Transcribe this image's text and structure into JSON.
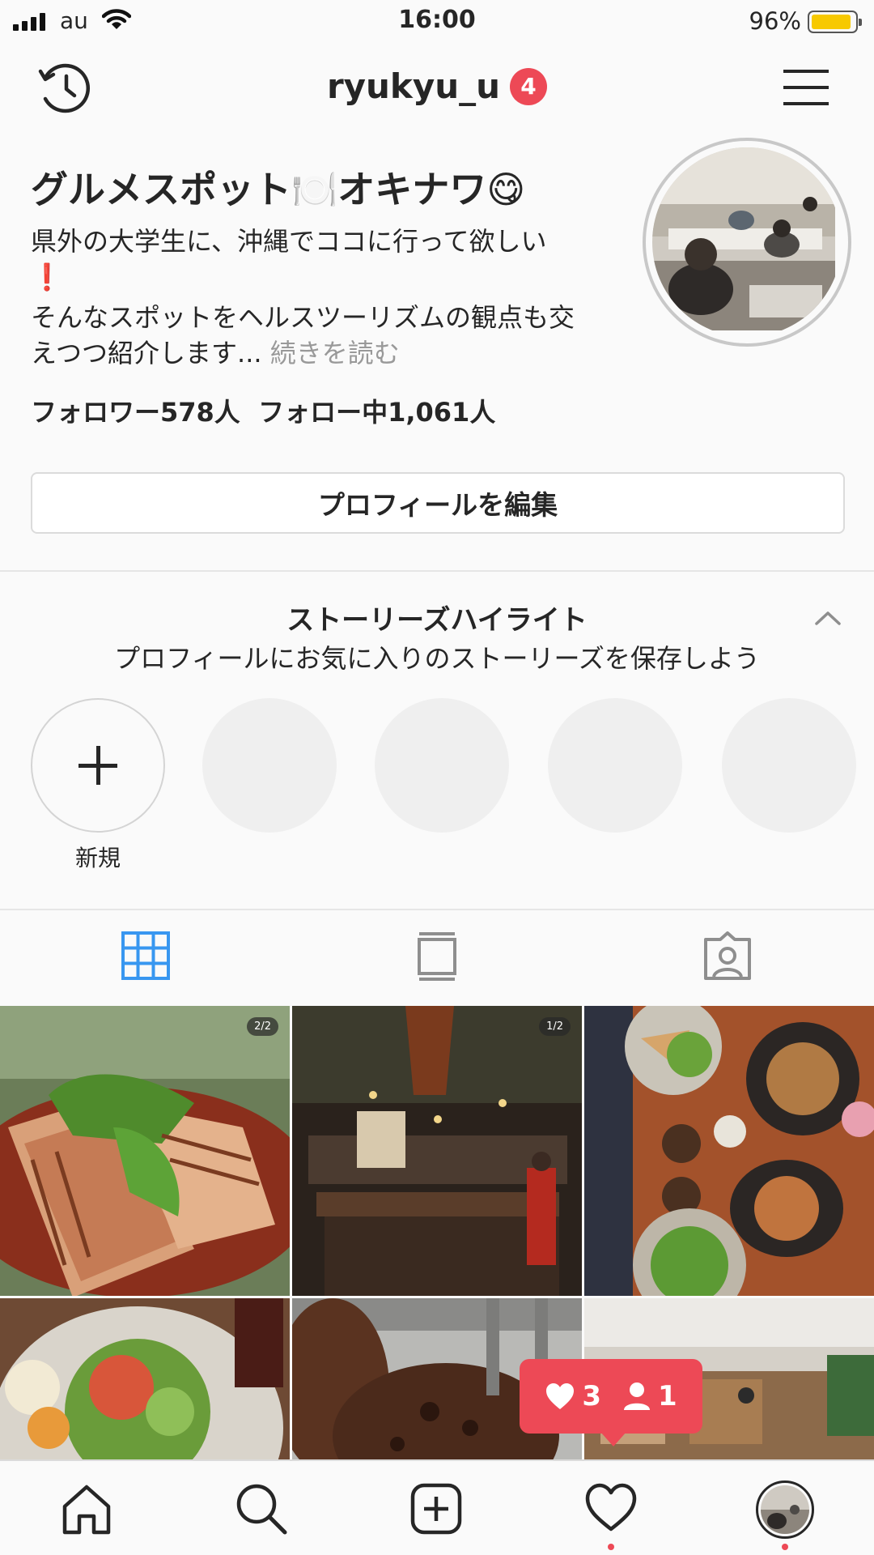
{
  "status_bar": {
    "carrier": "au",
    "time": "16:00",
    "battery": "96%"
  },
  "header": {
    "username": "ryukyu_u",
    "notification_count": "4"
  },
  "profile": {
    "name": "グルメスポット🍽️オキナワ😋",
    "bio_lines": [
      "県外の大学生に、沖縄でココに行って欲しい",
      "❗",
      "そんなスポットをヘルスツーリズムの観点も交",
      "えつつ紹介します..."
    ],
    "more_label": " 続きを読む",
    "followers": "フォロワー578人",
    "following": "フォロー中1,061人",
    "edit_button": "プロフィールを編集"
  },
  "highlights": {
    "title": "ストーリーズハイライト",
    "subtitle": "プロフィールにお気に入りのストーリーズを保存しよう",
    "new_label": "新規"
  },
  "posts": {
    "multi_counters": [
      "2/2",
      "1/2"
    ]
  },
  "activity_popup": {
    "likes": "3",
    "follows": "1"
  },
  "colors": {
    "accent": "#ed4956",
    "active_tab": "#3897f0",
    "battery": "#f7c900"
  }
}
